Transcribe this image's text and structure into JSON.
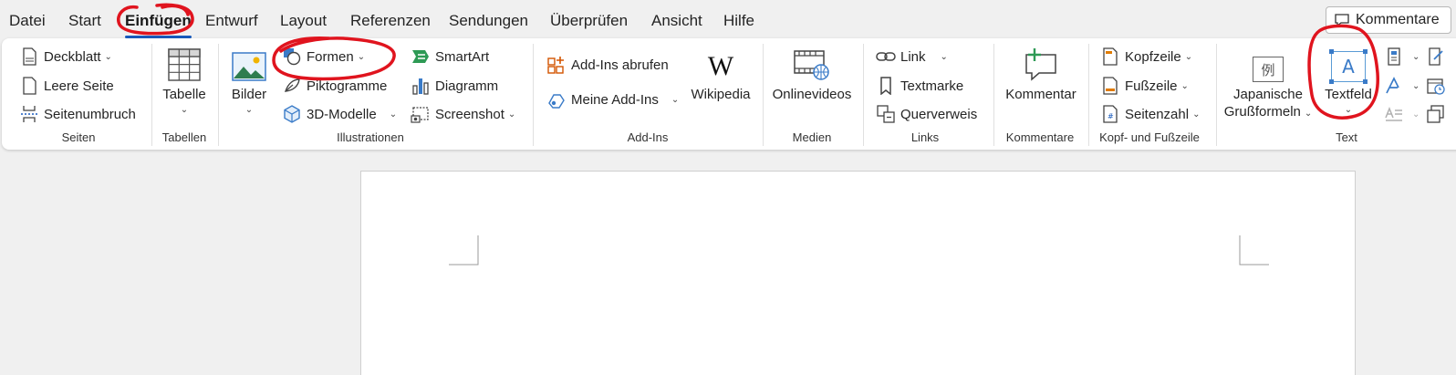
{
  "tabs": [
    "Datei",
    "Start",
    "Einfügen",
    "Entwurf",
    "Layout",
    "Referenzen",
    "Sendungen",
    "Überprüfen",
    "Ansicht",
    "Hilfe"
  ],
  "active_tab": "Einfügen",
  "comments_button": "Kommentare",
  "accent_color": "#185abd",
  "annotation_color": "#e0141e",
  "groups": {
    "seiten": {
      "label": "Seiten",
      "deckblatt": "Deckblatt",
      "leere_seite": "Leere Seite",
      "seitenumbruch": "Seitenumbruch"
    },
    "tabellen": {
      "label": "Tabellen",
      "tabelle": "Tabelle"
    },
    "illustrationen": {
      "label": "Illustrationen",
      "bilder": "Bilder",
      "formen": "Formen",
      "piktogramme": "Piktogramme",
      "modelle_3d": "3D-Modelle",
      "smartart": "SmartArt",
      "diagramm": "Diagramm",
      "screenshot": "Screenshot"
    },
    "addins": {
      "label": "Add-Ins",
      "abrufen": "Add-Ins abrufen",
      "meine": "Meine Add-Ins",
      "wikipedia": "Wikipedia"
    },
    "medien": {
      "label": "Medien",
      "onlinevideos": "Onlinevideos"
    },
    "links": {
      "label": "Links",
      "link": "Link",
      "textmarke": "Textmarke",
      "querverweis": "Querverweis"
    },
    "kommentare": {
      "label": "Kommentare",
      "kommentar": "Kommentar"
    },
    "kopf_fuss": {
      "label": "Kopf- und Fußzeile",
      "kopfzeile": "Kopfzeile",
      "fusszeile": "Fußzeile",
      "seitenzahl": "Seitenzahl"
    },
    "text": {
      "label": "Text",
      "japanisch_line1": "Japanische",
      "japanisch_line2": "Grußformeln",
      "japanisch_icon_char": "例",
      "textfeld": "Textfeld",
      "textfeld_icon_char": "A"
    }
  }
}
